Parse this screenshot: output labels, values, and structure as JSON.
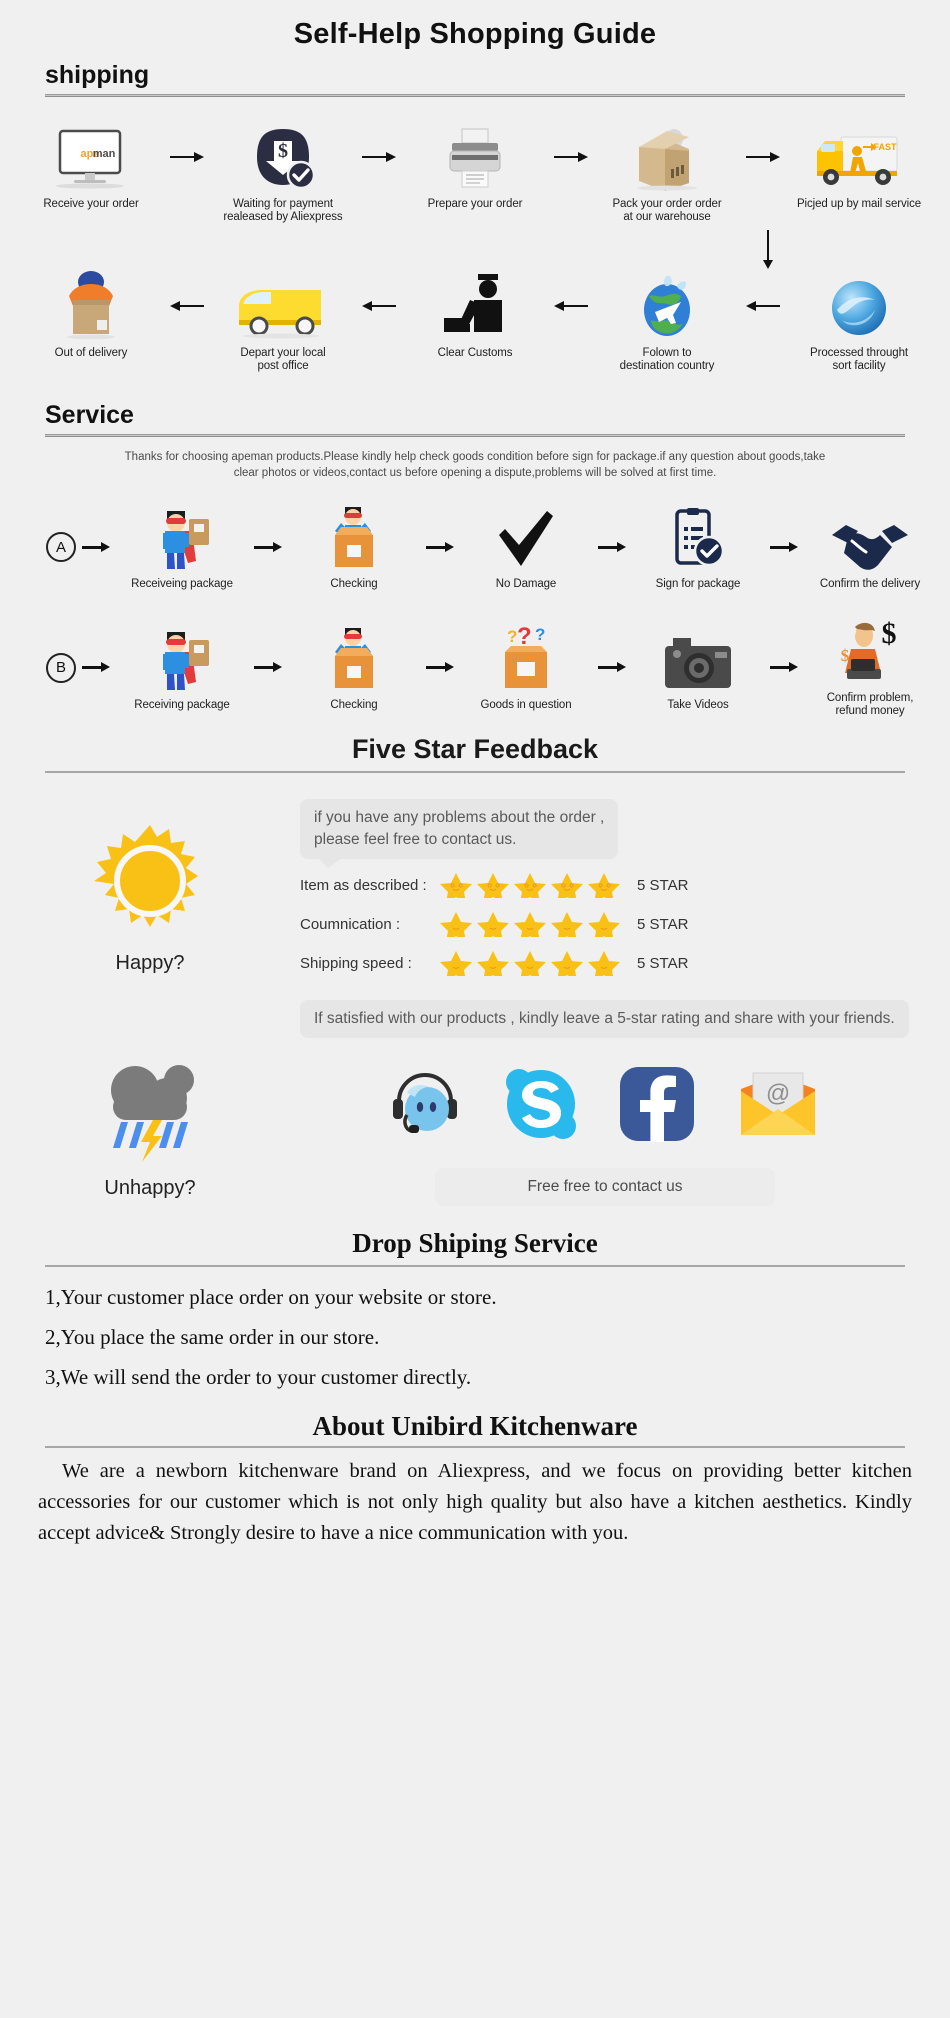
{
  "page": {
    "title": "Self-Help Shopping Guide",
    "background": "#f0f0f0"
  },
  "shipping": {
    "heading": "shipping",
    "row1": [
      {
        "label": "Receive your order",
        "icon": "monitor-apeman-icon"
      },
      {
        "label": "Waiting for payment\nrealeased by Aliexpress",
        "icon": "payment-dollar-icon"
      },
      {
        "label": "Prepare your order",
        "icon": "printer-icon"
      },
      {
        "label": "Pack your order order\nat our warehouse",
        "icon": "packing-box-icon"
      },
      {
        "label": "Picjed up by mail service",
        "icon": "delivery-truck-fast-icon"
      }
    ],
    "row2": [
      {
        "label": "Out of delivery",
        "icon": "courier-with-box-icon"
      },
      {
        "label": "Depart your local\npost office",
        "icon": "yellow-van-icon"
      },
      {
        "label": "Clear Customs",
        "icon": "customs-officer-icon"
      },
      {
        "label": "Folown to\ndestination country",
        "icon": "globe-airplane-icon"
      },
      {
        "label": "Processed throught\nsort facility",
        "icon": "blue-sphere-icon"
      }
    ]
  },
  "service": {
    "heading": "Service",
    "disclaimer": "Thanks for choosing apeman products.Please kindly help check goods condition before sign for package.if any question about goods,take clear photos or videos,contact us before opening a dispute,problems will be solved at first time.",
    "row_a": {
      "badge": "A",
      "steps": [
        {
          "label": "Receiveing package",
          "icon": "hero-receiving-package-icon"
        },
        {
          "label": "Checking",
          "icon": "hero-opening-box-icon"
        },
        {
          "label": "No Damage",
          "icon": "checkmark-icon"
        },
        {
          "label": "Sign for package",
          "icon": "signed-document-icon"
        },
        {
          "label": "Confirm the delivery",
          "icon": "handshake-icon"
        }
      ]
    },
    "row_b": {
      "badge": "B",
      "steps": [
        {
          "label": "Receiving package",
          "icon": "hero-receiving-package-icon"
        },
        {
          "label": "Checking",
          "icon": "hero-opening-box-icon"
        },
        {
          "label": "Goods in question",
          "icon": "question-box-icon"
        },
        {
          "label": "Take Videos",
          "icon": "camera-icon"
        },
        {
          "label": "Confirm problem,\nrefund money",
          "icon": "refund-agent-icon"
        }
      ]
    }
  },
  "feedback": {
    "title": "Five Star Feedback",
    "happy_label": "Happy?",
    "happy_icon": "sun-icon",
    "bubble_top": "if you have any problems about the order ,\nplease feel free to contact us.",
    "bubble_bottom": "If satisfied with our products ,  kindly leave\na 5-star rating and share with your friends.",
    "ratings": [
      {
        "label": "Item as described :",
        "stars": 5,
        "value": "5 STAR"
      },
      {
        "label": "Coumnication :",
        "stars": 5,
        "value": "5 STAR"
      },
      {
        "label": "Shipping speed :",
        "stars": 5,
        "value": "5 STAR"
      }
    ],
    "star_color": "#f9c116"
  },
  "contact": {
    "unhappy_label": "Unhappy?",
    "unhappy_icon": "storm-cloud-icon",
    "channels": [
      {
        "name": "trademanager-icon",
        "label": "TradeManager"
      },
      {
        "name": "skype-icon",
        "label": "Skype"
      },
      {
        "name": "facebook-icon",
        "label": "Facebook"
      },
      {
        "name": "email-icon",
        "label": "Email"
      }
    ],
    "button": "Free free to contact us"
  },
  "dropshipping": {
    "title": "Drop Shiping Service",
    "steps": [
      "1,Your customer place order on your website or store.",
      "2,You place the same order in our store.",
      "3,We will send the order to your customer directly."
    ]
  },
  "about": {
    "title": "About Unibird Kitchenware",
    "body": "We are a newborn kitchenware brand on Aliexpress, and we focus on providing better kitchen accessories for our customer which is not only high quality but also have a kitchen aesthetics. Kindly accept advice& Strongly desire to have a nice communication with you."
  }
}
